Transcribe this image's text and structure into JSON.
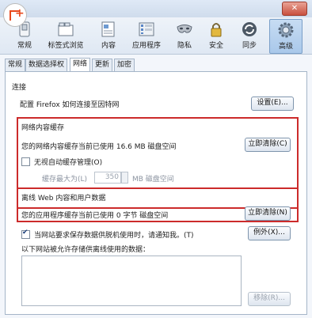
{
  "toolbar": {
    "items": [
      {
        "label": "常规"
      },
      {
        "label": "标签式浏览"
      },
      {
        "label": "内容"
      },
      {
        "label": "应用程序"
      },
      {
        "label": "隐私"
      },
      {
        "label": "安全"
      },
      {
        "label": "同步"
      },
      {
        "label": "高级"
      }
    ]
  },
  "tabs": [
    "常规",
    "数据选择权",
    "网络",
    "更新",
    "加密"
  ],
  "connection": {
    "title": "连接",
    "desc": "配置 Firefox 如何连接至因特网",
    "settings_button": "设置(E)..."
  },
  "cache": {
    "title": "网络内容缓存",
    "desc": "您的网络内容缓存当前已使用 16.6 MB 磁盘空间",
    "clear_button": "立即清除(C)",
    "override_label": "无视自动缓存管理(O)",
    "limit_label": "缓存最大为(L)",
    "limit_value": "350",
    "limit_unit": "MB 磁盘空间"
  },
  "offline": {
    "title": "离线 Web 内容和用户数据",
    "desc": "您的应用程序缓存当前已使用 0 字节 磁盘空间",
    "clear_button": "立即清除(N)",
    "notify_label": "当网站要求保存数据供脱机使用时，请通知我。(T)",
    "exceptions_button": "例外(X)...",
    "list_label": "以下网站被允许存储供离线使用的数据：",
    "remove_button": "移除(R)..."
  },
  "colors": {
    "highlight": "#cc2b2b",
    "accent": "#1b3e7a"
  }
}
